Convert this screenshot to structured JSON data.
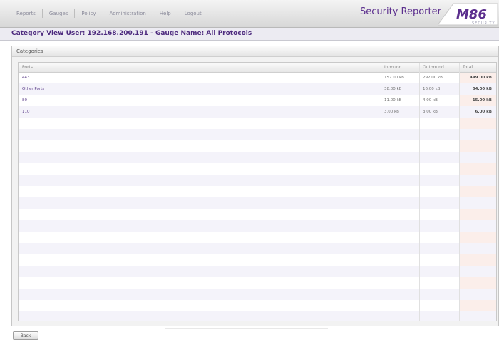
{
  "nav": {
    "items": [
      "Reports",
      "Gauges",
      "Policy",
      "Administration",
      "Help",
      "Logout"
    ]
  },
  "brand": {
    "product": "Security Reporter",
    "logo_text": "M86",
    "logo_sub": "SECURITY",
    "logo_color": "#5c2f8e"
  },
  "page": {
    "title": "Category View User: 192.168.200.191 - Gauge Name: All Protocols"
  },
  "panel": {
    "title": "Categories",
    "columns": [
      "Ports",
      "Inbound",
      "Outbound",
      "Total"
    ],
    "rows": [
      {
        "port": "443",
        "inbound": "157.00 kB",
        "outbound": "292.00 kB",
        "total": "449.00 kB"
      },
      {
        "port": "Other Ports",
        "inbound": "38.00 kB",
        "outbound": "16.00 kB",
        "total": "54.00 kB"
      },
      {
        "port": "80",
        "inbound": "11.00 kB",
        "outbound": "4.00 kB",
        "total": "15.00 kB"
      },
      {
        "port": "110",
        "inbound": "3.00 kB",
        "outbound": "3.00 kB",
        "total": "6.00 kB"
      }
    ]
  },
  "footer": {
    "back_label": "Back"
  }
}
